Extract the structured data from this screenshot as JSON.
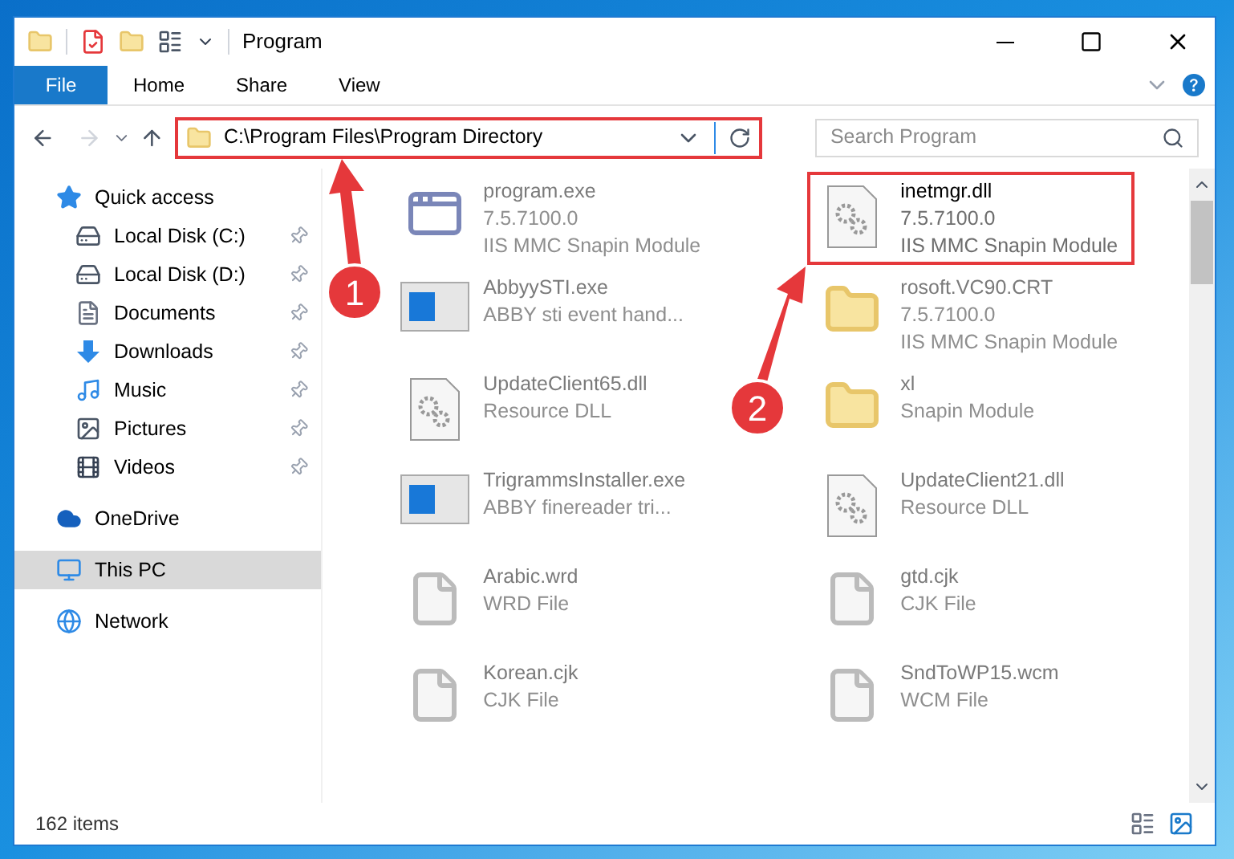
{
  "window": {
    "title": "Program"
  },
  "ribbon_tabs": [
    {
      "label": "File",
      "selected": true
    },
    {
      "label": "Home",
      "selected": false
    },
    {
      "label": "Share",
      "selected": false
    },
    {
      "label": "View",
      "selected": false
    }
  ],
  "address_bar": {
    "path": "C:\\Program Files\\Program Directory",
    "highlighted": true
  },
  "search": {
    "placeholder": "Search Program"
  },
  "sidebar": {
    "items": [
      {
        "label": "Quick access",
        "kind": "star",
        "selected": false,
        "children": [
          {
            "label": "Local Disk (C:)",
            "kind": "drive",
            "pinned": true,
            "selected": false
          },
          {
            "label": "Local Disk (D:)",
            "kind": "drive",
            "pinned": true,
            "selected": false
          },
          {
            "label": "Documents",
            "kind": "doc",
            "pinned": true,
            "selected": false
          },
          {
            "label": "Downloads",
            "kind": "download",
            "pinned": true,
            "selected": false
          },
          {
            "label": "Music",
            "kind": "music",
            "pinned": true,
            "selected": false
          },
          {
            "label": "Pictures",
            "kind": "picture",
            "pinned": true,
            "selected": false
          },
          {
            "label": "Videos",
            "kind": "film",
            "pinned": true,
            "selected": false
          }
        ]
      },
      {
        "label": "OneDrive",
        "kind": "cloud",
        "selected": false
      },
      {
        "label": "This PC",
        "kind": "monitor",
        "selected": true
      },
      {
        "label": "Network",
        "kind": "network",
        "selected": false
      }
    ]
  },
  "files": [
    {
      "name": "program.exe",
      "details": [
        "7.5.7100.0",
        "IIS MMC Snapin Module"
      ],
      "kind": "app",
      "highlighted": false
    },
    {
      "name": "inetmgr.dll",
      "details": [
        "7.5.7100.0",
        "IIS MMC Snapin Module"
      ],
      "kind": "dll",
      "highlighted": true
    },
    {
      "name": "AbbyySTI.exe",
      "details": [
        "ABBY sti event hand..."
      ],
      "kind": "window",
      "highlighted": false
    },
    {
      "name": "rosoft.VC90.CRT",
      "details": [
        "7.5.7100.0",
        "IIS MMC Snapin Module"
      ],
      "kind": "folder",
      "highlighted": false
    },
    {
      "name": "UpdateClient65.dll",
      "details": [
        "Resource DLL"
      ],
      "kind": "dll",
      "highlighted": false
    },
    {
      "name": "xl",
      "details": [
        "Snapin Module"
      ],
      "kind": "folder",
      "highlighted": false
    },
    {
      "name": "TrigrammsInstaller.exe",
      "details": [
        "ABBY finereader tri..."
      ],
      "kind": "window",
      "highlighted": false
    },
    {
      "name": "UpdateClient21.dll",
      "details": [
        "Resource DLL"
      ],
      "kind": "dll",
      "highlighted": false
    },
    {
      "name": "Arabic.wrd",
      "details": [
        "WRD File"
      ],
      "kind": "doc",
      "highlighted": false
    },
    {
      "name": "gtd.cjk",
      "details": [
        "CJK File"
      ],
      "kind": "doc",
      "highlighted": false
    },
    {
      "name": "Korean.cjk",
      "details": [
        "CJK File"
      ],
      "kind": "doc",
      "highlighted": false
    },
    {
      "name": "SndToWP15.wcm",
      "details": [
        "WCM File"
      ],
      "kind": "doc",
      "highlighted": false
    }
  ],
  "callouts": [
    {
      "label": "1"
    },
    {
      "label": "2"
    }
  ],
  "status_bar": {
    "item_count": "162 items"
  }
}
